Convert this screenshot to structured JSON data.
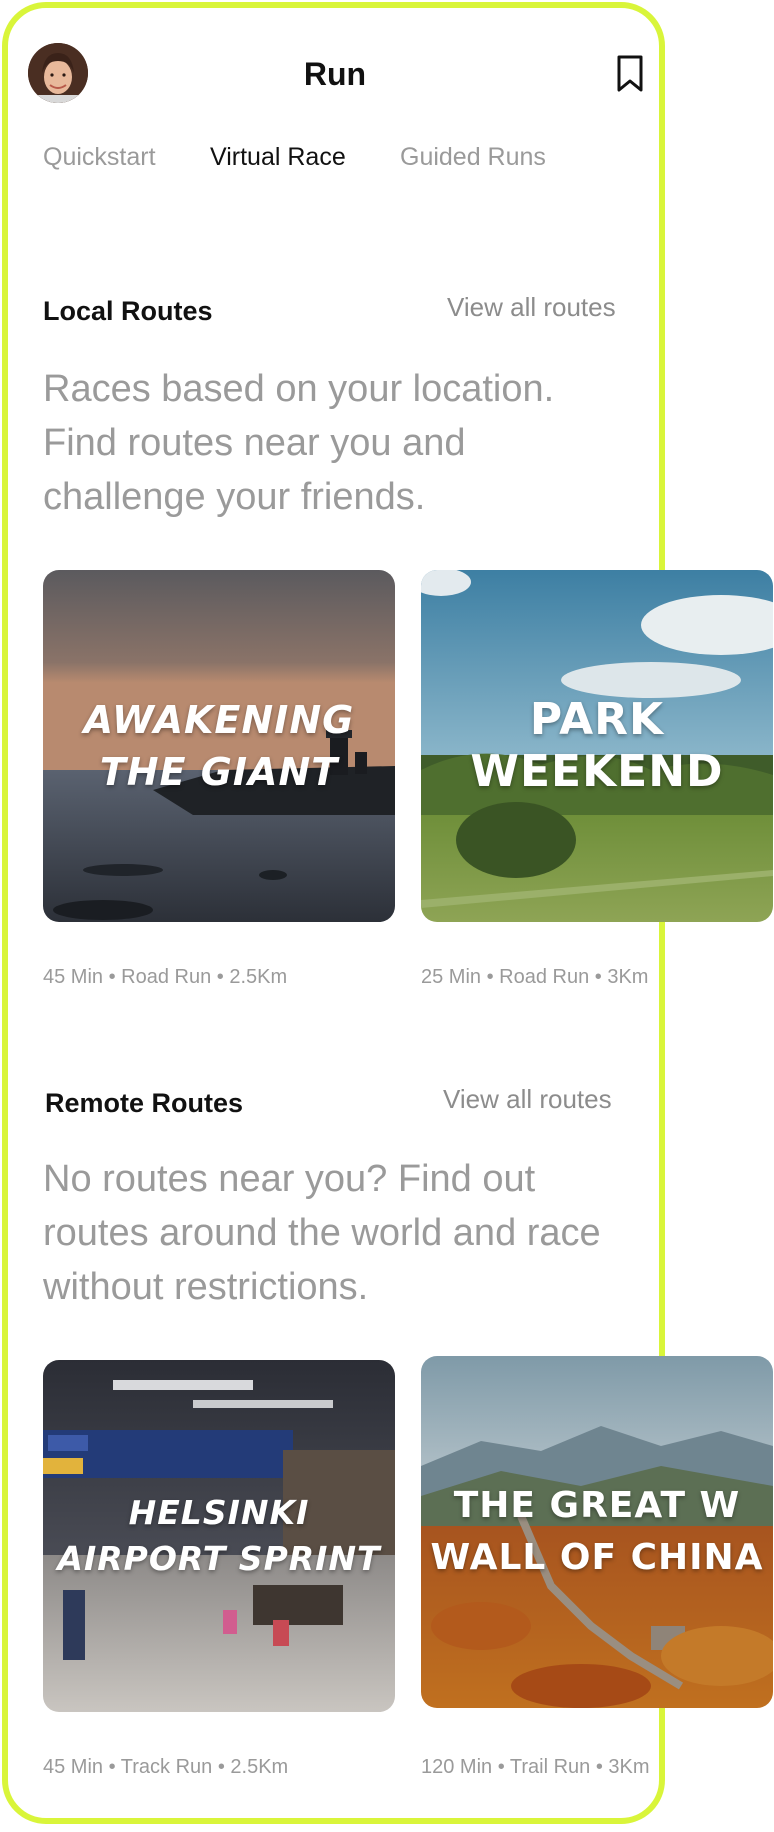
{
  "header": {
    "title": "Run",
    "avatar_icon": "user-avatar",
    "bookmark_icon": "bookmark-icon"
  },
  "tabs": [
    {
      "label": "Quickstart",
      "active": false
    },
    {
      "label": "Virtual Race",
      "active": true
    },
    {
      "label": "Guided Runs",
      "active": false
    }
  ],
  "local": {
    "title": "Local Routes",
    "view_all": "View all routes",
    "description": "Races based on your location. Find routes near you and challenge your friends.",
    "cards": [
      {
        "title": "AWAKENING\nTHE GIANT",
        "meta": "45 Min • Road Run • 2.5Km"
      },
      {
        "title": "PARK WEEKEND",
        "meta": "25 Min • Road Run • 3Km"
      }
    ]
  },
  "remote": {
    "title": "Remote Routes",
    "view_all": "View all routes",
    "description": "No routes near you? Find out routes around the world and race without restrictions.",
    "cards": [
      {
        "title": "HELSINKI\nAIRPORT SPRINT",
        "meta": "45 Min • Track Run • 2.5Km"
      },
      {
        "title": "THE GREAT W\nWALL OF CHINA",
        "meta": "120 Min • Trail Run • 3Km"
      }
    ]
  },
  "colors": {
    "frame": "#d9f53a",
    "text_primary": "#111111",
    "text_secondary": "#9a9a9a"
  }
}
